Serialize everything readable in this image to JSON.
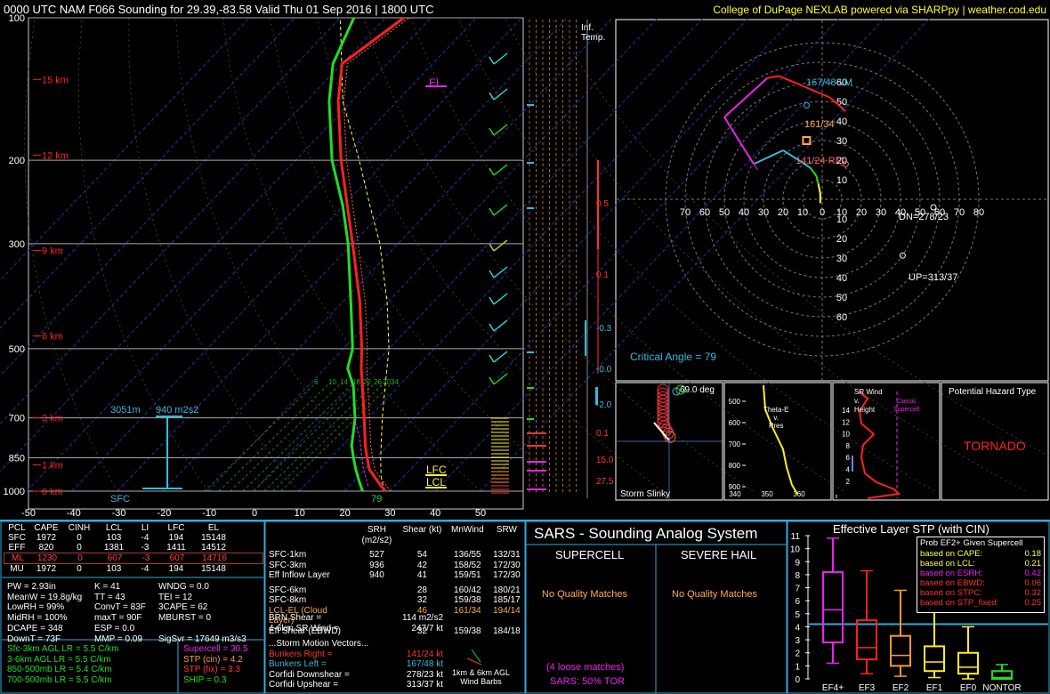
{
  "header": {
    "title": "0000 UTC NAM F066 Sounding for 29.39,-83.58 Valid  Thu 01 Sep 2016 | 1800 UTC",
    "credit": "College of DuPage NEXLAB powered via SHARPpy | weather.cod.edu"
  },
  "colors": {
    "temp": "#ff2020",
    "dew": "#22dd22",
    "parcel": "#ffff44",
    "cyan": "#33bbdd",
    "magenta": "#ee22ee",
    "yellow": "#ffee44",
    "border": "#33aadd"
  },
  "chart_data": [
    {
      "type": "line",
      "name": "skewt",
      "pressure_ticks": [
        {
          "p": 100,
          "label": "100"
        },
        {
          "p": 200,
          "label": "200"
        },
        {
          "p": 300,
          "label": "300"
        },
        {
          "p": 500,
          "label": "500"
        },
        {
          "p": 700,
          "label": "700"
        },
        {
          "p": 850,
          "label": "850"
        },
        {
          "p": 1000,
          "label": "1000"
        }
      ],
      "height_ticks": [
        {
          "p": 135,
          "label": "15 km"
        },
        {
          "p": 195,
          "label": "12 km"
        },
        {
          "p": 310,
          "label": "9 km"
        },
        {
          "p": 470,
          "label": "6 km"
        },
        {
          "p": 700,
          "label": "3 km"
        },
        {
          "p": 880,
          "label": "1 km"
        },
        {
          "p": 1000,
          "label": "0 km"
        }
      ],
      "temp_ticks": [
        "-50",
        "-40",
        "-30",
        "-20",
        "-10",
        "0",
        "10",
        "20",
        "30",
        "40",
        "50"
      ],
      "temperature": [
        [
          1000,
          29
        ],
        [
          950,
          25
        ],
        [
          900,
          21
        ],
        [
          850,
          18
        ],
        [
          800,
          15
        ],
        [
          700,
          9
        ],
        [
          600,
          2
        ],
        [
          550,
          -2
        ],
        [
          500,
          -6
        ],
        [
          400,
          -16
        ],
        [
          300,
          -30
        ],
        [
          250,
          -39
        ],
        [
          200,
          -50
        ],
        [
          150,
          -63
        ],
        [
          125,
          -70
        ],
        [
          100,
          -66
        ]
      ],
      "dewpoint": [
        [
          1000,
          24
        ],
        [
          950,
          21
        ],
        [
          900,
          18
        ],
        [
          850,
          15
        ],
        [
          800,
          12
        ],
        [
          700,
          7
        ],
        [
          600,
          0
        ],
        [
          550,
          -5
        ],
        [
          500,
          -8
        ],
        [
          400,
          -18
        ],
        [
          300,
          -31
        ],
        [
          250,
          -40
        ],
        [
          200,
          -52
        ],
        [
          150,
          -65
        ],
        [
          125,
          -72
        ],
        [
          100,
          -77
        ]
      ],
      "parcel": [
        [
          1000,
          29
        ],
        [
          950,
          26
        ],
        [
          900,
          23.5
        ],
        [
          850,
          21
        ],
        [
          700,
          13
        ],
        [
          600,
          7
        ],
        [
          500,
          0
        ],
        [
          400,
          -10
        ],
        [
          300,
          -24
        ],
        [
          250,
          -34
        ],
        [
          200,
          -46
        ],
        [
          150,
          -62
        ],
        [
          100,
          -80
        ]
      ],
      "annotations": {
        "el": "EL",
        "lfc": "LFC",
        "lcl": "LCL",
        "sfc": "SFC",
        "sfc_temp": "79",
        "eff_top": "3051m",
        "esrh": "940 m2s2",
        "mix_values": [
          "6",
          "10",
          "14",
          "18",
          "22",
          "26",
          "30",
          "34"
        ]
      },
      "panel_labels": {
        "inf_temp": "Inf.\nTemp.",
        "omega_vals": [
          "0.5",
          "0.1",
          "-0.3",
          "-0.0",
          "-2.0",
          "0.1",
          "15.0",
          "27.5"
        ]
      }
    },
    {
      "type": "line",
      "name": "hodograph",
      "rings": [
        "10",
        "20",
        "30",
        "40",
        "50",
        "60",
        "70",
        "80"
      ],
      "x_ticks": [
        "70",
        "60",
        "50",
        "40",
        "30",
        "20",
        "10",
        "0",
        "10",
        "20",
        "30",
        "40",
        "50",
        "60",
        "70",
        "80"
      ],
      "y_ticks": [
        "60",
        "50",
        "40",
        "30",
        "20",
        "10",
        "10",
        "20",
        "30",
        "40",
        "50",
        "60"
      ],
      "trace": [
        [
          -1,
          -2
        ],
        [
          -1,
          3
        ],
        [
          -2,
          8
        ],
        [
          -3,
          12
        ],
        [
          -6,
          16
        ],
        [
          -12,
          20
        ],
        [
          -20,
          25
        ],
        [
          -35,
          18
        ],
        [
          -50,
          42
        ],
        [
          -28,
          62
        ],
        [
          -22,
          63
        ],
        [
          4,
          52
        ],
        [
          12,
          45
        ]
      ],
      "labels": {
        "lm": "167/48 LM",
        "rm": "141/24 RM",
        "mid": "161/34",
        "dn": "DN=278/23",
        "up": "UP=313/37",
        "crit": "Critical Angle = 79"
      }
    }
  ],
  "slinky": {
    "label": "Storm Slinky",
    "deg": "69.0 deg"
  },
  "theta": {
    "label": "Theta-E\nv.\nPres",
    "x_ticks": [
      "340",
      "350",
      "360"
    ],
    "y_ticks": [
      "500",
      "600",
      "700",
      "800",
      "900"
    ]
  },
  "srwind": {
    "label": "SR Wind\nv.\nHeight",
    "y_ticks": [
      "14",
      "12",
      "10",
      "8",
      "6",
      "4",
      "2"
    ],
    "classic": "Classic\nSupercell"
  },
  "hazard": {
    "title": "Potential Hazard Type",
    "value": "TORNADO"
  },
  "parcel_table": {
    "headers": [
      "PCL",
      "CAPE",
      "CINH",
      "LCL",
      "LI",
      "LFC",
      "EL"
    ],
    "rows": [
      [
        "SFC",
        "1972",
        "0",
        "103",
        "-4",
        "194",
        "15148"
      ],
      [
        "EFF",
        "820",
        "0",
        "1381",
        "-3",
        "1411",
        "14512"
      ],
      [
        "ML",
        "1230",
        "0",
        "607",
        "-3",
        "607",
        "14716"
      ],
      [
        "MU",
        "1972",
        "0",
        "103",
        "-4",
        "194",
        "15148"
      ]
    ],
    "selected_row": 2
  },
  "indices": {
    "col1": [
      "PW = 2.93in",
      "MeanW = 19.8g/kg",
      "LowRH = 99%",
      "MidRH = 100%",
      "DCAPE = 348",
      "DownT = 73F"
    ],
    "col2": [
      "K = 41",
      "TT = 43",
      "ConvT = 83F",
      "maxT = 90F",
      "ESP = 0.0",
      "MMP = 0.09"
    ],
    "col3": [
      "WNDG = 0.0",
      "TEI = 12",
      "3CAPE = 62",
      "MBURST = 0",
      "",
      "SigSvr = 17649 m3/s3"
    ]
  },
  "lapse": [
    "Sfc-3km AGL LR = 5.5 C/km",
    "3-6km AGL LR = 5.5 C/km",
    "850-500mb LR = 5.4 C/km",
    "700-500mb LR = 5.5 C/km"
  ],
  "svr": [
    "Supercell = 30.5",
    "STP (cin) = 4.2",
    "STP (fix) = 3.3",
    "SHIP = 0.3"
  ],
  "kinematics": {
    "headers": [
      "",
      "SRH (m2/s2)",
      "Shear (kt)",
      "MnWind",
      "SRW"
    ],
    "rows": [
      [
        "SFC-1km",
        "527",
        "54",
        "136/55",
        "132/31"
      ],
      [
        "SFC-3km",
        "936",
        "42",
        "158/52",
        "172/30"
      ],
      [
        "Eff Inflow Layer",
        "940",
        "41",
        "159/51",
        "172/30"
      ],
      [
        "SFC-6km",
        "",
        "28",
        "160/42",
        "180/21"
      ],
      [
        "SFC-8km",
        "",
        "32",
        "159/38",
        "185/17"
      ],
      [
        "LCL-EL (Cloud Layer)",
        "",
        "46",
        "161/34",
        "194/14"
      ],
      [
        "Eff Shear (EBWD)",
        "",
        "32",
        "159/38",
        "184/18"
      ]
    ],
    "brn_label": "BRN Shear =",
    "brn": "114 m2/s2",
    "sr46_label": "4-6km SR Wind =",
    "sr46": "247/7 kt",
    "sm_title": "...Storm Motion Vectors...",
    "sm": [
      [
        "Bunkers Right =",
        "141/24 kt"
      ],
      [
        "Bunkers Left =",
        "167/48 kt"
      ],
      [
        "Corfidi Downshear =",
        "278/23 kt"
      ],
      [
        "Corfidi Upshear =",
        "313/37 kt"
      ]
    ],
    "barbs_label": "1km & 6km AGL\nWind Barbs"
  },
  "sars": {
    "title": "SARS - Sounding Analog System",
    "supercell": "SUPERCELL",
    "hail": "SEVERE HAIL",
    "match1": "No Quality Matches",
    "match2": "No Quality Matches",
    "loose": "(4 loose matches)",
    "tor": "SARS: 50% TOR"
  },
  "stp": {
    "title": "Effective Layer STP (with CIN)",
    "y_ticks": [
      "0",
      "1",
      "2",
      "3",
      "4",
      "5",
      "6",
      "7",
      "8",
      "9",
      "10",
      "11"
    ],
    "categories": [
      "EF4+",
      "EF3",
      "EF2",
      "EF1",
      "EF0",
      "NONTOR"
    ],
    "box_colors": [
      "#ee22ee",
      "#ff2020",
      "#ff9922",
      "#ffee22",
      "#ffee22",
      "#22dd22"
    ],
    "boxes": [
      [
        1.2,
        2.8,
        5.3,
        8.2,
        10.8
      ],
      [
        0.4,
        1.5,
        2.4,
        4.5,
        8.3
      ],
      [
        0.2,
        1.0,
        1.8,
        3.3,
        6.8
      ],
      [
        0.1,
        0.6,
        1.3,
        2.5,
        5.2
      ],
      [
        0.0,
        0.4,
        0.9,
        2.0,
        4.0
      ],
      [
        0.0,
        0.0,
        0.1,
        0.6,
        1.1
      ]
    ],
    "marker": 4.2,
    "prob_title": "Prob EF2+ Given Supercell",
    "prob": [
      [
        "based on CAPE:",
        "0.18"
      ],
      [
        "based on LCL:",
        "0.21"
      ],
      [
        "based on ESRH:",
        "0.42"
      ],
      [
        "based on EBWD:",
        "0.06"
      ],
      [
        "based on STPC:",
        "0.32"
      ],
      [
        "based on STP_fixed:",
        "0.25"
      ]
    ],
    "prob_colors": [
      "#ffff44",
      "#ffff44",
      "#ee22ee",
      "#ff3030",
      "#ff3030",
      "#ff3030"
    ]
  }
}
